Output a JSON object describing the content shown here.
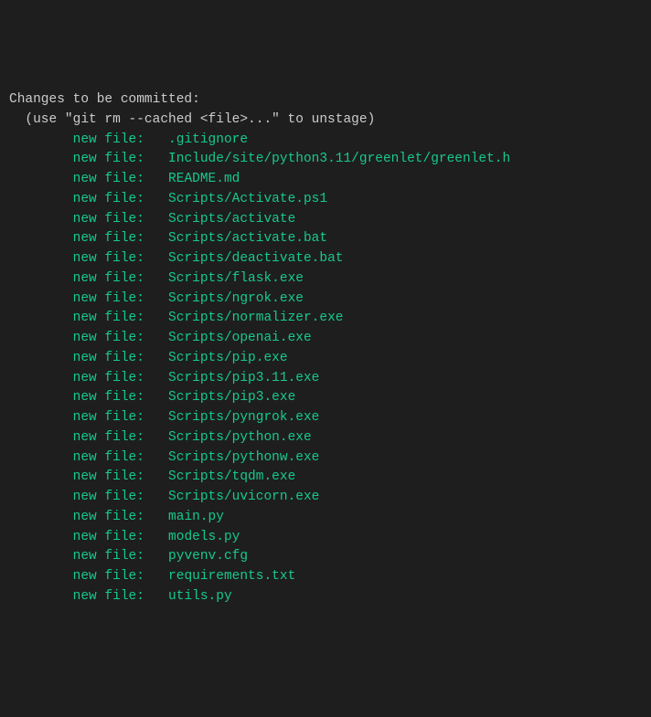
{
  "header": {
    "title": "Changes to be committed:",
    "hint": "  (use \"git rm --cached <file>...\" to unstage)"
  },
  "indent": "        ",
  "statusLabel": "new file:   ",
  "files": [
    ".gitignore",
    "Include/site/python3.11/greenlet/greenlet.h",
    "README.md",
    "Scripts/Activate.ps1",
    "Scripts/activate",
    "Scripts/activate.bat",
    "Scripts/deactivate.bat",
    "Scripts/flask.exe",
    "Scripts/ngrok.exe",
    "Scripts/normalizer.exe",
    "Scripts/openai.exe",
    "Scripts/pip.exe",
    "Scripts/pip3.11.exe",
    "Scripts/pip3.exe",
    "Scripts/pyngrok.exe",
    "Scripts/python.exe",
    "Scripts/pythonw.exe",
    "Scripts/tqdm.exe",
    "Scripts/uvicorn.exe",
    "main.py",
    "models.py",
    "pyvenv.cfg",
    "requirements.txt",
    "utils.py"
  ]
}
